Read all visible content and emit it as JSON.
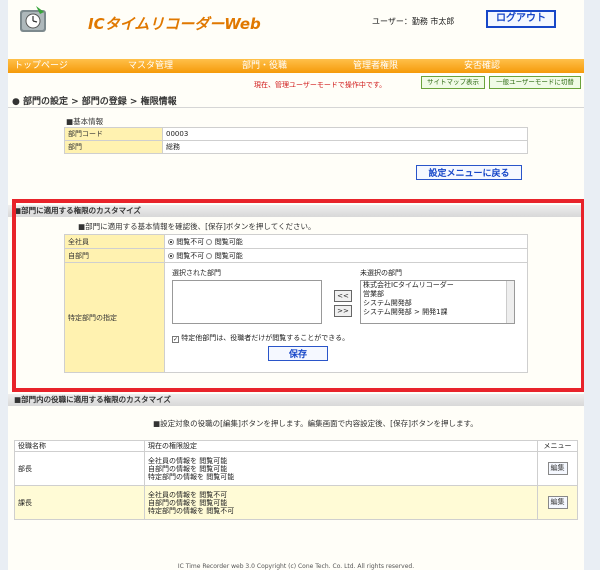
{
  "header": {
    "app_title": "ICタイムリコーダーWeb",
    "user_label": "ユーザー：勤務 市太郎",
    "logout": "ログアウト"
  },
  "nav": [
    "トップページ",
    "マスタ管理",
    "部門・役職",
    "管理者権限",
    "安否確認"
  ],
  "mode_text": "現在、管理ユーザーモードで操作中です。",
  "sitemap_button": "サイトマップ表示",
  "general_mode_button": "一般ユーザーモードに切替",
  "breadcrumb": "● 部門の設定 > 部門の登録 > 権限情報",
  "basic_info": {
    "heading": "■基本情報",
    "rows": [
      {
        "label": "部門コード",
        "value": "00003"
      },
      {
        "label": "部門",
        "value": "総務"
      }
    ]
  },
  "back_button": "設定メニューに戻る",
  "custom_section": {
    "title": "■部門に適用する権限のカスタマイズ",
    "instruction": "■部門に適用する基本情報を確認後、[保存]ボタンを押してください。",
    "all_staff_label": "全社員",
    "own_dept_label": "自部門",
    "deny": "閲覧不可",
    "allow": "閲覧可能",
    "specific_label": "特定部門の指定",
    "selected_header": "選択された部門",
    "unselected_header": "未選択の部門",
    "unselected_items": [
      "株式会社ICタイムリコーダー",
      "営業部",
      "システム開発部",
      "システム開発部 > 開発1課"
    ],
    "add_btn": "<<",
    "remove_btn": ">>",
    "checkbox_label": "特定他部門は、役職者だけが閲覧することができる。",
    "save": "保存"
  },
  "position_section": {
    "title": "■部門内の役職に適用する権限のカスタマイズ",
    "instruction": "■設定対象の役職の[編集]ボタンを押します。編集画面で内容設定後、[保存]ボタンを押します。",
    "col_name": "役職名称",
    "col_current": "現在の権限設定",
    "col_menu": "メニュー",
    "edit": "編集",
    "rows": [
      {
        "name": "部長",
        "lines": [
          "全社員の情報を 閲覧可能",
          "自部門の情報を 閲覧可能",
          "特定部門の情報を 閲覧可能"
        ]
      },
      {
        "name": "課長",
        "lines": [
          "全社員の情報を 閲覧不可",
          "自部門の情報を 閲覧可能",
          "特定部門の情報を 閲覧不可"
        ]
      }
    ]
  },
  "copyright": "IC Time Recorder web 3.0 Copyright (c) Cone Tech. Co. Ltd. All rights reserved."
}
